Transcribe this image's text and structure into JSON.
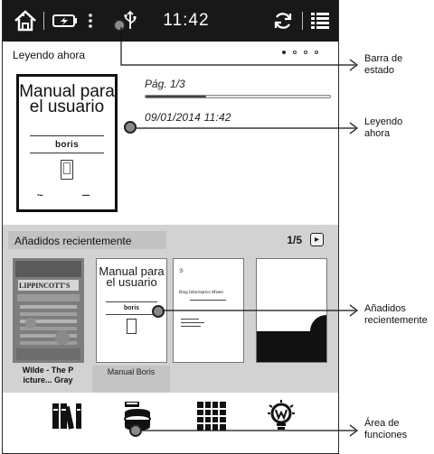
{
  "status_bar": {
    "time": "11:42",
    "icons": [
      "home-icon",
      "battery-charging-icon",
      "more-vertical-icon",
      "usb-icon",
      "sync-icon",
      "menu-list-icon"
    ]
  },
  "reading_now": {
    "title": "Leyendo ahora",
    "carousel_pages": 4,
    "carousel_active": 1,
    "book": {
      "cover_title": "Manual para el usuario",
      "cover_brand": "boris",
      "page": "Pág. 1/3",
      "progress": 0.33,
      "date": "09/01/2014 11:42"
    }
  },
  "recently_added": {
    "title": "Añadidos recientemente",
    "pager": "1/5",
    "books": [
      {
        "caption": "Wilde - The P icture... Gray",
        "cover_text": "LIPPINCOTT'S"
      },
      {
        "caption": "Manual Boris",
        "cover_title": "Manual para el usuario",
        "cover_brand": "boris"
      },
      {
        "cover_text": "Blog Informativo Mister"
      },
      {}
    ]
  },
  "function_bar": {
    "buttons": [
      "library-icon",
      "store-icon",
      "apps-grid-icon",
      "tips-icon"
    ]
  },
  "callouts": {
    "status_bar": "Barra de estado",
    "reading_now": "Leyendo ahora",
    "recently_added": "Añadidos recientemente",
    "functions": "Área de funciones"
  },
  "colors": {
    "status_bar_bg": "#181818",
    "recent_bg": "#d2d2d2"
  }
}
